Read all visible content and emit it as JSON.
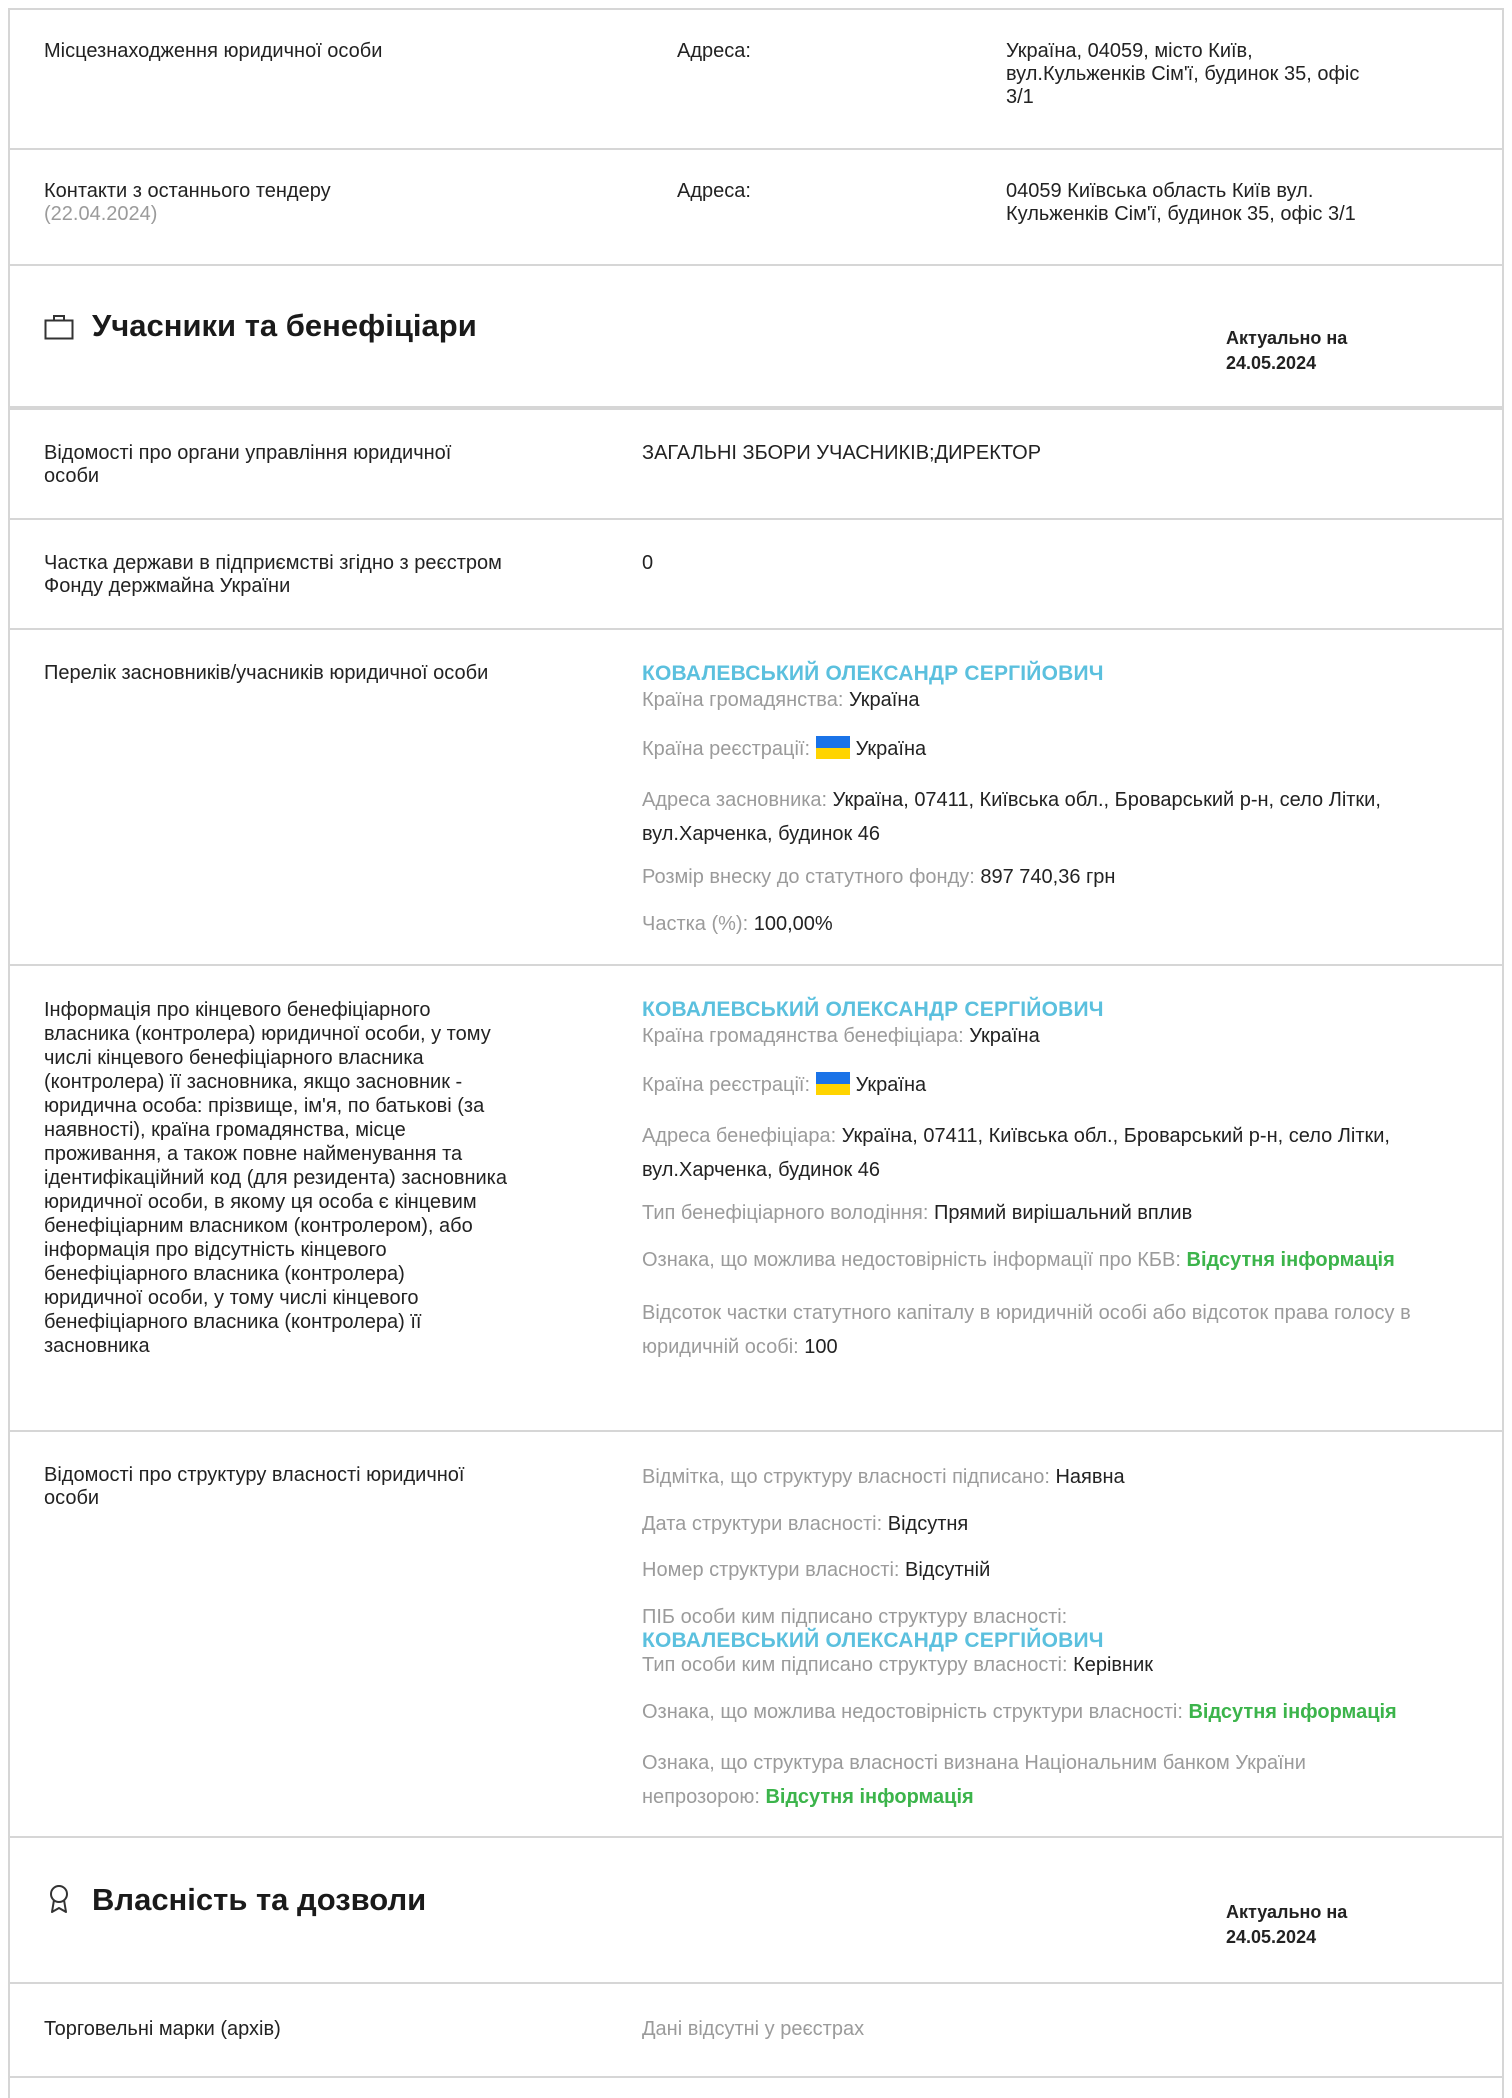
{
  "location": {
    "label": "Місцезнаходження юридичної особи",
    "addr_label": "Адреса:",
    "addr_lines": [
      "Україна, 04059, місто Київ,",
      "вул.Кульженків Сім'ї, будинок 35, офіс",
      "3/1"
    ]
  },
  "contacts": {
    "label": "Контакти з останнього тендеру",
    "date": "(22.04.2024)",
    "addr_label": "Адреса:",
    "addr_lines": [
      "04059 Київська область Київ вул.",
      "Кульженків Сім'ї, будинок 35, офіс 3/1"
    ]
  },
  "participants": {
    "icon": "briefcase-icon",
    "title": "Учасники та бенефіціари",
    "actual_label": "Актуально на",
    "actual_date": "24.05.2024",
    "governance": {
      "label_lines": [
        "Відомості про органи управління юридичної",
        "особи"
      ],
      "value": "ЗАГАЛЬНІ ЗБОРИ УЧАСНИКІВ;ДИРЕКТОР"
    },
    "state_share": {
      "label_lines": [
        "Частка держави в підприємстві згідно з реєстром",
        "Фонду держмайна України"
      ],
      "value": "0"
    },
    "founders": {
      "label": "Перелік засновників/учасників юридичної особи",
      "name": "КОВАЛЕВСЬКИЙ ОЛЕКСАНДР СЕРГІЙОВИЧ",
      "citizenship_label": "Країна громадянства:",
      "citizenship": "Україна",
      "registration_label": "Країна реєстрації:",
      "registration": "Україна",
      "address_label": "Адреса засновника:",
      "address_line1": "Україна, 07411, Київська обл., Броварський р-н, село Літки,",
      "address_line2": "вул.Харченка, будинок 46",
      "contribution_label": "Розмір внеску до статутного фонду:",
      "contribution": "897 740,36 грн",
      "share_label": "Частка (%):",
      "share": "100,00%"
    },
    "beneficiary": {
      "label_lines": [
        "Інформація про кінцевого бенефіціарного",
        "власника (контролера) юридичної особи, у тому",
        "числі кінцевого бенефіціарного власника",
        "(контролера) її засновника, якщо засновник -",
        "юридична особа: прізвище, ім'я, по батькові (за",
        "наявності), країна громадянства, місце",
        "проживання, а також повне найменування та",
        "ідентифікаційний код (для резидента) засновника",
        "юридичної особи, в якому ця особа є кінцевим",
        "бенефіціарним власником (контролером), або",
        "інформація про відсутність кінцевого",
        "бенефіціарного власника (контролера)",
        "юридичної особи, у тому числі кінцевого",
        "бенефіціарного власника (контролера) її",
        "засновника"
      ],
      "name": "КОВАЛЕВСЬКИЙ ОЛЕКСАНДР СЕРГІЙОВИЧ",
      "citizenship_label": "Країна громадянства бенефіціара:",
      "citizenship": "Україна",
      "registration_label": "Країна реєстрації:",
      "registration": "Україна",
      "address_label": "Адреса бенефіціара:",
      "address_line1": "Україна, 07411, Київська обл., Броварський р-н, село Літки,",
      "address_line2": "вул.Харченка, будинок 46",
      "ownership_type_label": "Тип бенефіціарного володіння:",
      "ownership_type": "Прямий вирішальний вплив",
      "unreliable_label": "Ознака, що можлива недостовірність інформації про КБВ:",
      "unreliable": "Відсутня інформація",
      "percent_label_line1": "Відсоток частки статутного капіталу в юридичній особі або відсоток права голосу в",
      "percent_label_line2": "юридичній особі:",
      "percent": "100"
    },
    "structure": {
      "label_lines": [
        "Відомості про структуру власності юридичної",
        "особи"
      ],
      "signed_label": "Відмітка, що структуру власності підписано:",
      "signed": "Наявна",
      "date_label": "Дата структури власності:",
      "date": "Відсутня",
      "number_label": "Номер структури власності:",
      "number": "Відсутній",
      "signer_label": "ПІБ особи ким підписано структуру власності:",
      "signer": "КОВАЛЕВСЬКИЙ ОЛЕКСАНДР СЕРГІЙОВИЧ",
      "signer_type_label": "Тип особи ким підписано структуру власності:",
      "signer_type": "Керівник",
      "unreliable_label": "Ознака, що можлива недостовірність структури власності:",
      "unreliable": "Відсутня інформація",
      "opaque_label_line1": "Ознака, що структура власності визнана Національним банком України",
      "opaque_label_line2": "непрозорою:",
      "opaque": "Відсутня інформація"
    }
  },
  "property": {
    "icon": "award-icon",
    "title": "Власність та дозволи",
    "actual_label": "Актуально на",
    "actual_date": "24.05.2024",
    "trademarks_label": "Торговельні марки (архів)",
    "trademarks_value": "Дані відсутні у реєстрах"
  },
  "colors": {
    "accent_name": "#5bc0de",
    "status_green": "#3cb44b",
    "border": "#d6d6d6"
  }
}
